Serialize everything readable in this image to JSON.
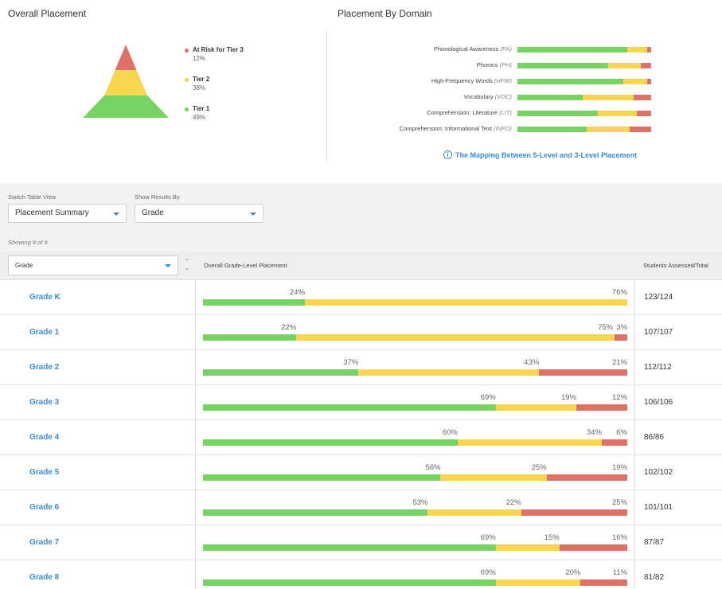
{
  "overall": {
    "title": "Overall Placement",
    "legend": [
      {
        "label": "At Risk for Tier 3",
        "pct": "12%",
        "color": "#de7168"
      },
      {
        "label": "Tier 2",
        "pct": "38%",
        "color": "#f8d64f"
      },
      {
        "label": "Tier 1",
        "pct": "49%",
        "color": "#77d364"
      }
    ]
  },
  "domain": {
    "title": "Placement By Domain",
    "rows": [
      {
        "name": "Phonological Awareness",
        "abbr": "(PA)",
        "g": 82,
        "y": 15,
        "r": 3
      },
      {
        "name": "Phonics",
        "abbr": "(PH)",
        "g": 68,
        "y": 24,
        "r": 8
      },
      {
        "name": "High-Frequency Words",
        "abbr": "(HFW)",
        "g": 79,
        "y": 18,
        "r": 3
      },
      {
        "name": "Vocabulary",
        "abbr": "(VOC)",
        "g": 49,
        "y": 38,
        "r": 13
      },
      {
        "name": "Comprehension: Literature",
        "abbr": "(LIT)",
        "g": 60,
        "y": 29,
        "r": 11
      },
      {
        "name": "Comprehension: Informational Text",
        "abbr": "(INFO)",
        "g": 52,
        "y": 32,
        "r": 16
      }
    ],
    "mapping_link": "The Mapping Between 5-Level and 3-Level Placement"
  },
  "controls": {
    "table_view_label": "Switch Table View",
    "table_view_value": "Placement Summary",
    "results_by_label": "Show Results By",
    "results_by_value": "Grade",
    "showing": "Showing 9 of 9"
  },
  "table": {
    "sort_value": "Grade",
    "col_placement": "Overall Grade-Level Placement",
    "col_students": "Students Assessed/Total",
    "rows": [
      {
        "grade": "Grade K",
        "g": 24,
        "y": 76,
        "r": 0,
        "gl": "24%",
        "yl": "76%",
        "rl": "",
        "students": "123/124"
      },
      {
        "grade": "Grade 1",
        "g": 22,
        "y": 75,
        "r": 3,
        "gl": "22%",
        "yl": "75%",
        "rl": "3%",
        "students": "107/107"
      },
      {
        "grade": "Grade 2",
        "g": 37,
        "y": 43,
        "r": 21,
        "gl": "37%",
        "yl": "43%",
        "rl": "21%",
        "students": "112/112"
      },
      {
        "grade": "Grade 3",
        "g": 69,
        "y": 19,
        "r": 12,
        "gl": "69%",
        "yl": "19%",
        "rl": "12%",
        "students": "106/106"
      },
      {
        "grade": "Grade 4",
        "g": 60,
        "y": 34,
        "r": 6,
        "gl": "60%",
        "yl": "34%",
        "rl": "6%",
        "students": "86/86"
      },
      {
        "grade": "Grade 5",
        "g": 56,
        "y": 25,
        "r": 19,
        "gl": "56%",
        "yl": "25%",
        "rl": "19%",
        "students": "102/102"
      },
      {
        "grade": "Grade 6",
        "g": 53,
        "y": 22,
        "r": 25,
        "gl": "53%",
        "yl": "22%",
        "rl": "25%",
        "students": "101/101"
      },
      {
        "grade": "Grade 7",
        "g": 69,
        "y": 15,
        "r": 16,
        "gl": "69%",
        "yl": "15%",
        "rl": "16%",
        "students": "87/87"
      },
      {
        "grade": "Grade 8",
        "g": 69,
        "y": 20,
        "r": 11,
        "gl": "69%",
        "yl": "20%",
        "rl": "11%",
        "students": "81/82"
      }
    ]
  },
  "colors": {
    "green": "#77d364",
    "yellow": "#f8d64f",
    "red": "#de7168",
    "link": "#3d8bd4"
  }
}
